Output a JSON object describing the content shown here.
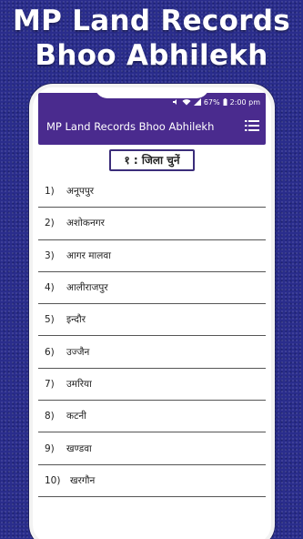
{
  "promo": {
    "line1": "MP Land Records",
    "line2": "Bhoo Abhilekh"
  },
  "status_bar": {
    "battery": "67%",
    "time": "2:00 pm"
  },
  "app": {
    "title": "MP Land Records Bhoo Abhilekh"
  },
  "section": {
    "label": "१ : जिला चुनें"
  },
  "districts": [
    {
      "num": "1)",
      "name": "अनूपपुर"
    },
    {
      "num": "2)",
      "name": "अशोकनगर"
    },
    {
      "num": "3)",
      "name": "आगर मालवा"
    },
    {
      "num": "4)",
      "name": "आलीराजपुर"
    },
    {
      "num": "5)",
      "name": "इन्दौर"
    },
    {
      "num": "6)",
      "name": "उज्जैन"
    },
    {
      "num": "7)",
      "name": "उमरिया"
    },
    {
      "num": "8)",
      "name": "कटनी"
    },
    {
      "num": "9)",
      "name": "खण्डवा"
    },
    {
      "num": "10)",
      "name": "खरगौन"
    }
  ],
  "icons": {
    "menu": "list-menu-icon",
    "wifi": "wifi-icon",
    "signal": "signal-icon",
    "battery": "battery-icon"
  },
  "colors": {
    "header": "#4a2b8e",
    "background": "#2a2d8c"
  }
}
